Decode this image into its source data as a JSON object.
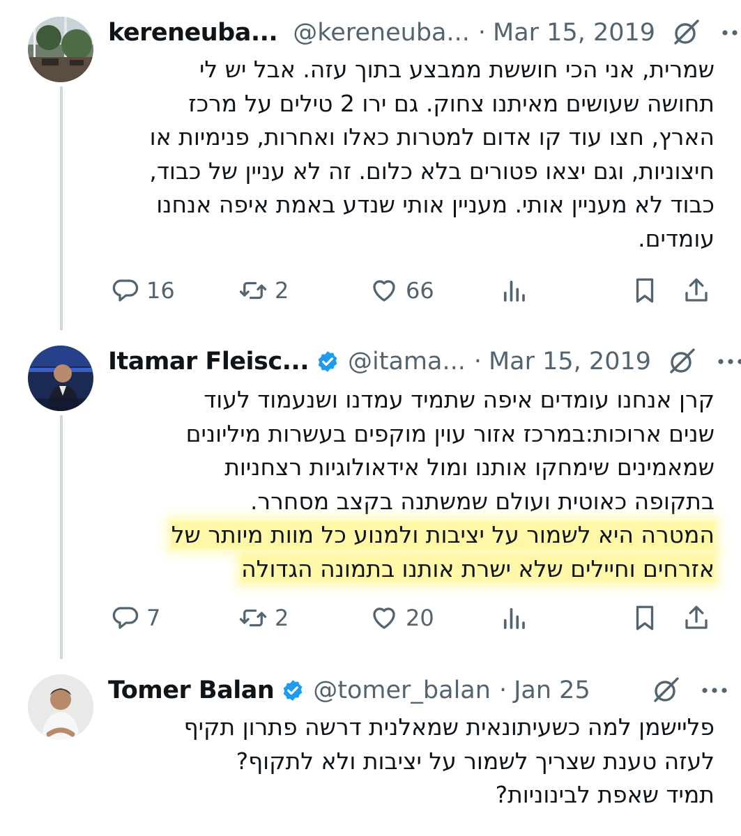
{
  "colors": {
    "verified": "#1d9bf0",
    "muted": "#536471",
    "highlight": "#fff58c",
    "thread_line": "#cfd9de"
  },
  "tweets": [
    {
      "name": "kereneuba...",
      "handle": "@kereneuba...",
      "separator": "·",
      "date": "Mar 15, 2019",
      "verified": false,
      "lines": [
        "שמרית, אני הכי חוששת ממבצע בתוך עזה. אבל יש לי",
        "תחושה שעושים מאיתנו צחוק. גם ירו 2 טילים על  מרכז",
        "הארץ, חצו עוד קו אדום למטרות כאלו ואחרות, פנימיות או",
        "חיצוניות, וגם יצאו פטורים בלא כלום. זה לא עניין של כבוד,",
        "כבוד לא מעניין אותי. מעניין אותי שנדע באמת איפה אנחנו",
        "עומדים."
      ],
      "stats": {
        "replies": "16",
        "retweets": "2",
        "likes": "66"
      }
    },
    {
      "name": "Itamar Fleisc...",
      "handle": "@itama...",
      "separator": "·",
      "date": "Mar 15, 2019",
      "verified": true,
      "lines": [
        "קרן אנחנו עומדים איפה שתמיד עמדנו ושנעמוד לעוד",
        "שנים ארוכות:במרכז אזור עוין מוקפים בעשרות מיליונים",
        "שמאמינים שימחקו אותנו ומול אידאולוגיות רצחניות",
        "בתקופה כאוטית ועולם שמשתנה בקצב מסחרר."
      ],
      "highlighted_lines": [
        "המטרה היא לשמור על יציבות ולמנוע כל מוות מיותר של",
        "אזרחים וחיילים שלא ישרת אותנו בתמונה הגדולה"
      ],
      "stats": {
        "replies": "7",
        "retweets": "2",
        "likes": "20"
      }
    },
    {
      "name": "Tomer Balan",
      "handle": "@tomer_balan",
      "separator": "·",
      "date": "Jan 25",
      "verified": true,
      "lines": [
        "פליישמן למה כשעיתונאית שמאלנית דרשה פתרון תקיף",
        "לעזה טענת שצריך לשמור על יציבות ולא לתקוף?",
        "תמיד שאפת לבינוניות?"
      ]
    }
  ]
}
